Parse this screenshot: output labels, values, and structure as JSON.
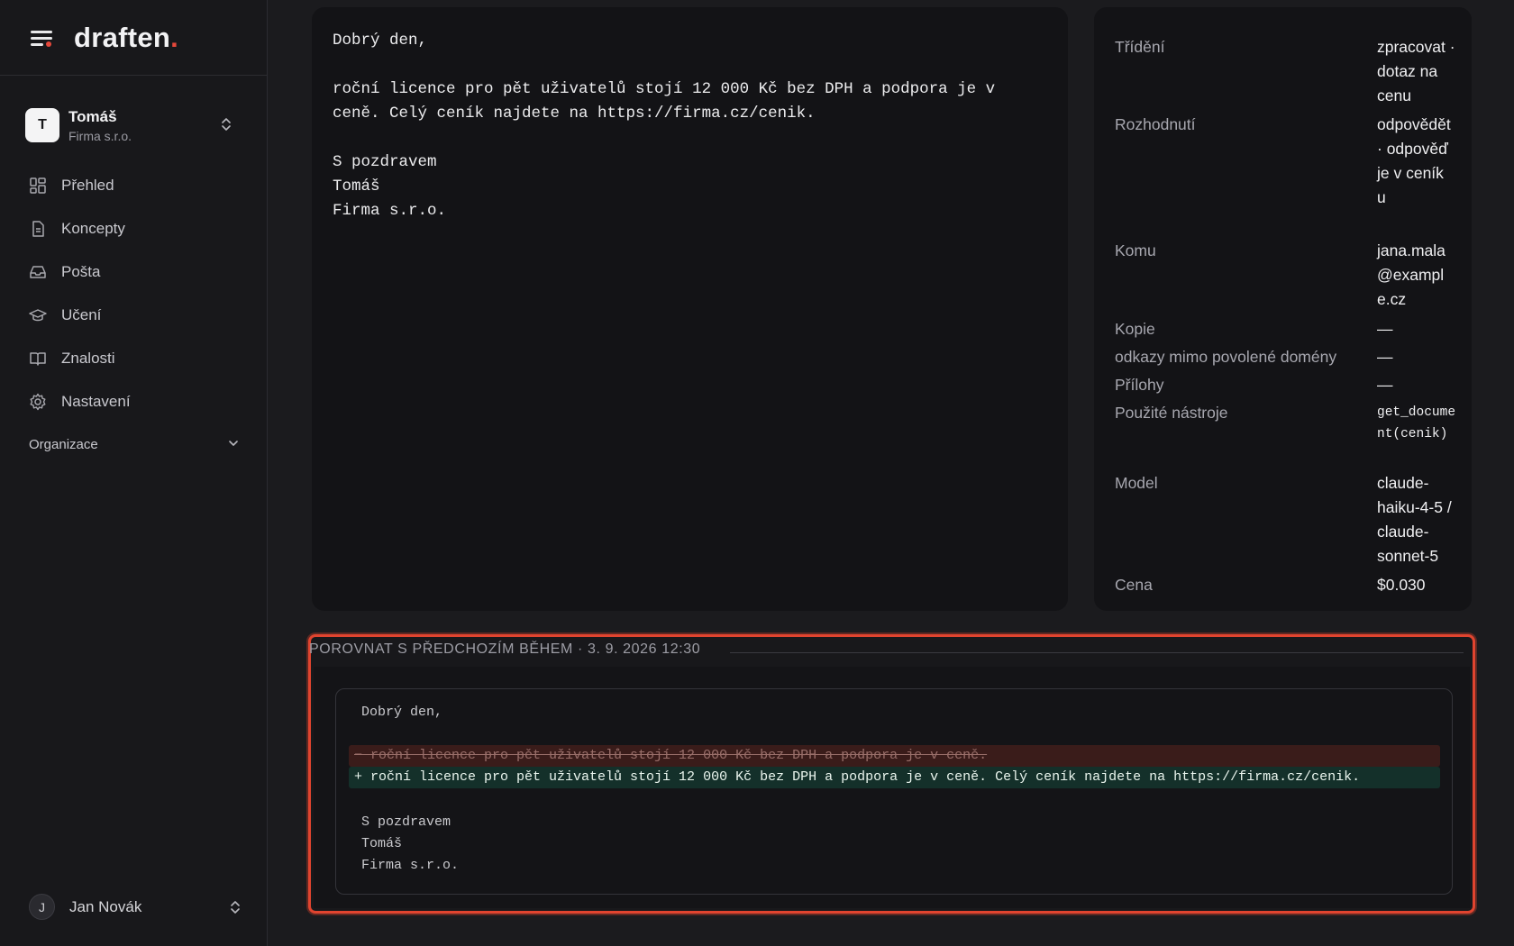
{
  "brand": {
    "name": "draften",
    "dot": "."
  },
  "org_switcher": {
    "initial": "T",
    "name": "Tomáš",
    "company": "Firma s.r.o."
  },
  "nav": [
    {
      "label": "Přehled",
      "icon": "dashboard-icon"
    },
    {
      "label": "Koncepty",
      "icon": "document-icon"
    },
    {
      "label": "Pošta",
      "icon": "inbox-icon"
    },
    {
      "label": "Učení",
      "icon": "graduation-cap-icon"
    },
    {
      "label": "Znalosti",
      "icon": "book-icon"
    },
    {
      "label": "Nastavení",
      "icon": "gear-icon"
    }
  ],
  "org_section": {
    "label": "Organizace"
  },
  "user": {
    "initial": "J",
    "name": "Jan Novák"
  },
  "email": {
    "body": "Dobrý den,\n\nroční licence pro pět uživatelů stojí 12 000 Kč bez DPH a podpora je v\nceně. Celý ceník najdete na https://firma.cz/cenik.\n\nS pozdravem\nTomáš\nFirma s.r.o."
  },
  "meta": [
    {
      "key": "Třídění",
      "value": "zpracovat · dotaz na cenu"
    },
    {
      "key": "Rozhodnutí",
      "value": "odpovědět · odpověď je v ceníku"
    },
    {
      "key": "Komu",
      "value": "jana.mala@example.cz"
    },
    {
      "key": "Kopie",
      "value": "—"
    },
    {
      "key": "odkazy mimo povolené domény",
      "value": "—"
    },
    {
      "key": "Přílohy",
      "value": "—"
    },
    {
      "key": "Použité nástroje",
      "value": "get_document(cenik)"
    },
    {
      "key": "Model",
      "value": "claude-haiku-4-5 / claude-sonnet-5"
    },
    {
      "key": "Cena",
      "value": "$0.030"
    }
  ],
  "compare": {
    "title": "POROVNAT S PŘEDCHOZÍM BĚHEM · 3. 9. 2026 12:30",
    "line_greeting": "Dobrý den,",
    "removed": "− roční licence pro pět uživatelů stojí 12 000 Kč bez DPH a podpora je v ceně.",
    "added": "+ roční licence pro pět uživatelů stojí 12 000 Kč bez DPH a podpora je v ceně. Celý ceník najdete na https://firma.cz/cenik.",
    "sign_1": "S pozdravem",
    "sign_2": "Tomáš",
    "sign_3": "Firma s.r.o."
  },
  "colors": {
    "accent": "#e5483b",
    "highlight_border": "#e0442f",
    "diff_removed_bg": "#3a1c1a",
    "diff_added_bg": "#14302a"
  }
}
